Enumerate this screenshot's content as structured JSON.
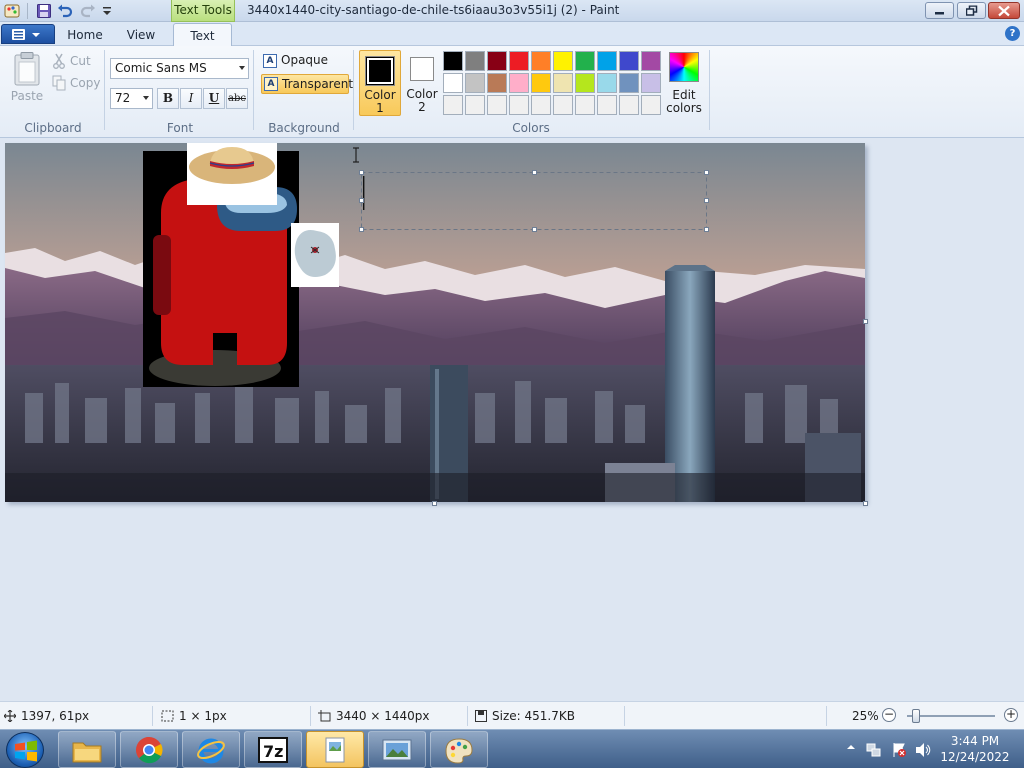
{
  "titlebar": {
    "text_tools_label": "Text Tools",
    "window_title": "3440x1440-city-santiago-de-chile-ts6iaau3o3v55i1j (2) - Paint"
  },
  "tabs": {
    "home": "Home",
    "view": "View",
    "text": "Text"
  },
  "clipboard": {
    "paste": "Paste",
    "cut": "Cut",
    "copy": "Copy",
    "group_label": "Clipboard"
  },
  "font": {
    "family": "Comic Sans MS",
    "size": "72",
    "bold": "B",
    "italic": "I",
    "underline": "U",
    "strikethrough": "abc",
    "group_label": "Font"
  },
  "background": {
    "opaque": "Opaque",
    "transparent": "Transparent",
    "icon_letter": "A",
    "group_label": "Background"
  },
  "colors": {
    "color1_line1": "Color",
    "color1_line2": "1",
    "color2_line1": "Color",
    "color2_line2": "2",
    "edit_line1": "Edit",
    "edit_line2": "colors",
    "group_label": "Colors",
    "color1_value": "#000000",
    "color2_value": "#ffffff",
    "palette_row1": [
      "#000000",
      "#7f7f7f",
      "#880015",
      "#ed1c24",
      "#ff7f27",
      "#fff200",
      "#22b14c",
      "#00a2e8",
      "#3f48cc",
      "#a349a4"
    ],
    "palette_row2": [
      "#ffffff",
      "#c3c3c3",
      "#b97a57",
      "#ffaec9",
      "#ffc90e",
      "#efe4b0",
      "#b5e61d",
      "#99d9ea",
      "#7092be",
      "#c8bfe7"
    ],
    "palette_row3": [
      "#f0f0f0",
      "#f0f0f0",
      "#f0f0f0",
      "#f0f0f0",
      "#f0f0f0",
      "#f0f0f0",
      "#f0f0f0",
      "#f0f0f0",
      "#f0f0f0",
      "#f0f0f0"
    ]
  },
  "status": {
    "cursor_pos": "1397, 61px",
    "selection_size": "1 × 1px",
    "image_size": "3440 × 1440px",
    "file_size": "Size: 451.7KB",
    "zoom": "25%",
    "zoom_level_fraction": 0.25
  },
  "taskbar": {
    "time": "3:44 PM",
    "date": "12/24/2022",
    "apps": [
      "file-explorer",
      "chrome",
      "internet-explorer",
      "7zip",
      "paint-document",
      "photo-viewer",
      "paint"
    ]
  }
}
